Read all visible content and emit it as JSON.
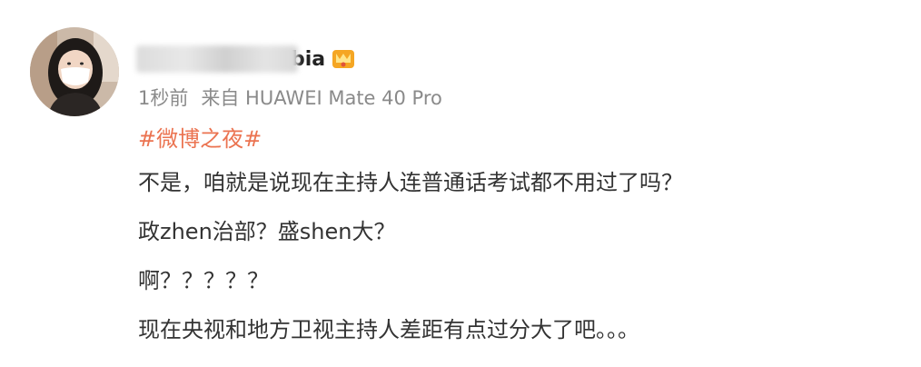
{
  "post": {
    "username_visible": "bia",
    "meta_time": "1秒前",
    "meta_source": "来自 HUAWEI Mate 40 Pro",
    "topic": "#微博之夜#",
    "lines": [
      "不是，咱就是说现在主持人连普通话考试都不用过了吗？",
      "政zhen治部？盛shen大？",
      "啊？？？？？",
      "现在央视和地方卫视主持人差距有点过分大了吧。。。"
    ]
  },
  "icons": {
    "avatar": "user-avatar-photo",
    "vip": "vip-badge-icon"
  },
  "colors": {
    "topic": "#eb7350",
    "meta": "#8a8a8a",
    "text": "#333333"
  }
}
